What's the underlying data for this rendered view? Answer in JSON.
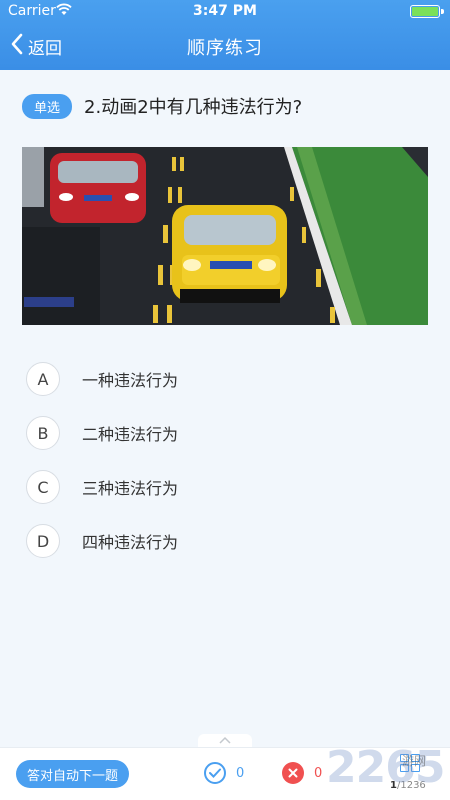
{
  "status_bar": {
    "carrier": "Carrier",
    "time": "3:47 PM"
  },
  "nav": {
    "back_label": "返回",
    "title": "顺序练习"
  },
  "question": {
    "type_badge": "单选",
    "text": "2.动画2中有几种违法行为?"
  },
  "options": [
    {
      "letter": "A",
      "text": "一种违法行为"
    },
    {
      "letter": "B",
      "text": "二种违法行为"
    },
    {
      "letter": "C",
      "text": "三种违法行为"
    },
    {
      "letter": "D",
      "text": "四种违法行为"
    }
  ],
  "bottom": {
    "auto_next_label": "答对自动下一题",
    "correct_count": "0",
    "wrong_count": "0",
    "current": "1",
    "total": "/1236"
  },
  "watermark": {
    "brand": "2265",
    "site": "游网"
  },
  "colors": {
    "accent": "#4a9ff0",
    "wrong": "#f05050",
    "battery": "#7be05a"
  },
  "icons": [
    "wifi-icon",
    "battery-icon",
    "chevron-left-icon",
    "check-icon",
    "close-icon",
    "grid-list-icon",
    "chevron-up-icon"
  ]
}
